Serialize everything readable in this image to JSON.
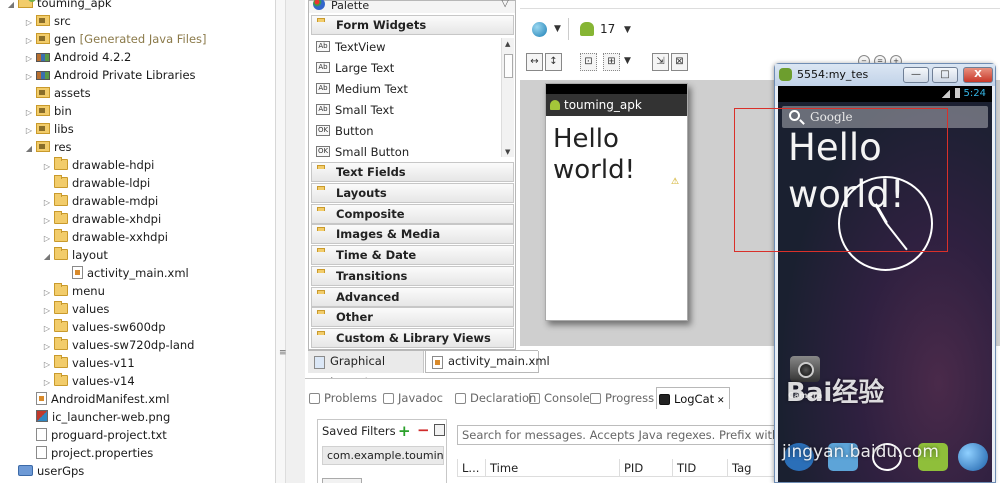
{
  "explorer": {
    "items": [
      {
        "label": "touming_apk",
        "depth": 0,
        "twisty": "open",
        "icon": "project"
      },
      {
        "label": "src",
        "depth": 1,
        "twisty": "closed",
        "icon": "pkgfolder"
      },
      {
        "label": "gen",
        "suffix": "[Generated Java Files]",
        "depth": 1,
        "twisty": "closed",
        "icon": "pkgfolder"
      },
      {
        "label": "Android 4.2.2",
        "depth": 1,
        "twisty": "closed",
        "icon": "lib"
      },
      {
        "label": "Android Private Libraries",
        "depth": 1,
        "twisty": "closed",
        "icon": "lib"
      },
      {
        "label": "assets",
        "depth": 1,
        "twisty": "",
        "icon": "pkgfolder"
      },
      {
        "label": "bin",
        "depth": 1,
        "twisty": "closed",
        "icon": "pkgfolder"
      },
      {
        "label": "libs",
        "depth": 1,
        "twisty": "closed",
        "icon": "pkgfolder"
      },
      {
        "label": "res",
        "depth": 1,
        "twisty": "open",
        "icon": "pkgfolder"
      },
      {
        "label": "drawable-hdpi",
        "depth": 2,
        "twisty": "closed",
        "icon": "folder"
      },
      {
        "label": "drawable-ldpi",
        "depth": 2,
        "twisty": "",
        "icon": "folder"
      },
      {
        "label": "drawable-mdpi",
        "depth": 2,
        "twisty": "closed",
        "icon": "folder"
      },
      {
        "label": "drawable-xhdpi",
        "depth": 2,
        "twisty": "closed",
        "icon": "folder"
      },
      {
        "label": "drawable-xxhdpi",
        "depth": 2,
        "twisty": "closed",
        "icon": "folder"
      },
      {
        "label": "layout",
        "depth": 2,
        "twisty": "open",
        "icon": "folder"
      },
      {
        "label": "activity_main.xml",
        "depth": 3,
        "twisty": "",
        "icon": "xml"
      },
      {
        "label": "menu",
        "depth": 2,
        "twisty": "closed",
        "icon": "folder"
      },
      {
        "label": "values",
        "depth": 2,
        "twisty": "closed",
        "icon": "folder"
      },
      {
        "label": "values-sw600dp",
        "depth": 2,
        "twisty": "closed",
        "icon": "folder"
      },
      {
        "label": "values-sw720dp-land",
        "depth": 2,
        "twisty": "closed",
        "icon": "folder"
      },
      {
        "label": "values-v11",
        "depth": 2,
        "twisty": "closed",
        "icon": "folder"
      },
      {
        "label": "values-v14",
        "depth": 2,
        "twisty": "closed",
        "icon": "folder"
      },
      {
        "label": "AndroidManifest.xml",
        "depth": 1,
        "twisty": "",
        "icon": "xml"
      },
      {
        "label": "ic_launcher-web.png",
        "depth": 1,
        "twisty": "",
        "icon": "png"
      },
      {
        "label": "proguard-project.txt",
        "depth": 1,
        "twisty": "",
        "icon": "file"
      },
      {
        "label": "project.properties",
        "depth": 1,
        "twisty": "",
        "icon": "file"
      },
      {
        "label": "userGps",
        "depth": 0,
        "twisty": "",
        "icon": "proj2"
      }
    ]
  },
  "palette": {
    "title": "Palette",
    "form_widgets": "Form Widgets",
    "widgets": [
      "TextView",
      "Large Text",
      "Medium Text",
      "Small Text",
      "Button",
      "Small Button"
    ],
    "widget_badges": [
      "Ab",
      "Ab",
      "Ab",
      "Ab",
      "OK",
      "OK"
    ],
    "categories": [
      "Text Fields",
      "Layouts",
      "Composite",
      "Images & Media",
      "Time & Date",
      "Transitions",
      "Advanced",
      "Other",
      "Custom & Library Views"
    ]
  },
  "editor_tabs": {
    "graphical": "Graphical Layout",
    "xml": "activity_main.xml"
  },
  "canvas_toolbar": {
    "api_level": "17"
  },
  "preview": {
    "app_title": "touming_apk",
    "hello": "Hello world!",
    "warning_glyph": "⚠"
  },
  "emulator": {
    "window_title": "5554:my_tes",
    "min": "—",
    "max": "□",
    "close": "X",
    "clock_time": "5:24",
    "search_hint": "Google",
    "hello": "Hello world!",
    "camera_label": "Camera"
  },
  "bottom": {
    "tabs": [
      "Problems",
      "Javadoc",
      "Declaration",
      "Console",
      "Progress",
      "LogCat"
    ],
    "active_tab": "LogCat",
    "saved_filters": "Saved Filters",
    "filter_item": "com.example.touming",
    "search_placeholder": "Search for messages. Accepts Java regexes. Prefix with pid:",
    "columns": [
      "L...",
      "Time",
      "PID",
      "TID",
      "Tag"
    ]
  },
  "watermark": {
    "text": "Bai经验",
    "url": "jingyan.baidu.com"
  },
  "colors": {
    "selection": "#d9302a",
    "logcat_active": "#111111"
  }
}
